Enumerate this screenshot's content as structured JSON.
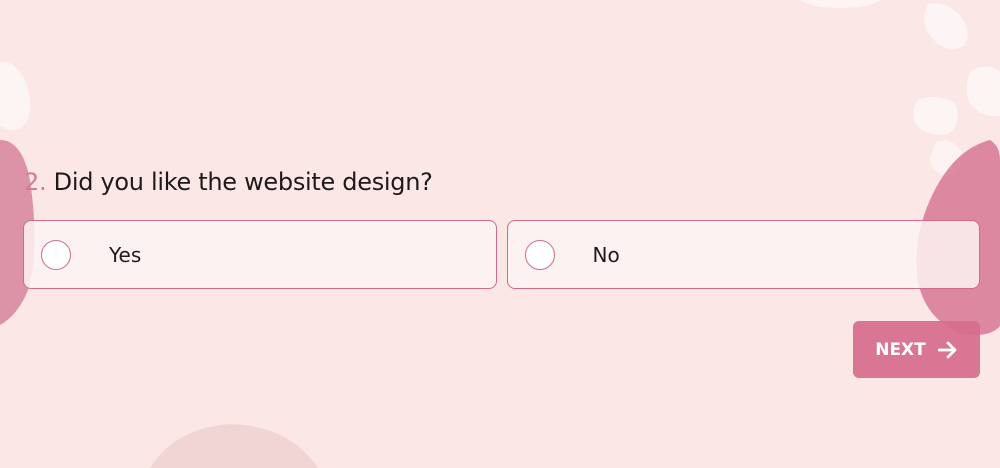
{
  "question": {
    "number": "2.",
    "text": "Did you like the website design?"
  },
  "options": [
    {
      "label": "Yes"
    },
    {
      "label": "No"
    }
  ],
  "next_button": {
    "label": "NEXT",
    "icon": "arrow-right-icon"
  },
  "colors": {
    "background": "#fae7e6",
    "accent": "#d66c8d",
    "border": "#d06c8b",
    "option_background": "#fdf3f3",
    "text": "#1e1a1b"
  }
}
